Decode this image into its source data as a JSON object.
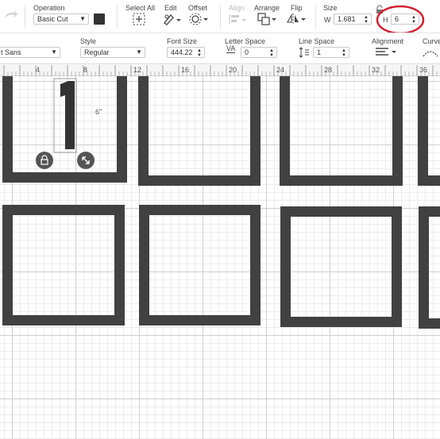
{
  "toolbar": {
    "operation": {
      "label": "Operation",
      "value": "Basic Cut",
      "color": "#333333"
    },
    "select_all": {
      "label": "Select All"
    },
    "edit": {
      "label": "Edit"
    },
    "offset": {
      "label": "Offset"
    },
    "align": {
      "label": "Align"
    },
    "arrange": {
      "label": "Arrange"
    },
    "flip": {
      "label": "Flip"
    },
    "size": {
      "label": "Size",
      "w_label": "W",
      "w_value": "1.681",
      "h_label": "H",
      "h_value": "6"
    }
  },
  "text_toolbar": {
    "font_name": "t Sans",
    "style": {
      "label": "Style",
      "value": "Regular"
    },
    "font_size": {
      "label": "Font Size",
      "value": "444.22"
    },
    "letter_space": {
      "label": "Letter Space",
      "icon_text": "VA",
      "value": "0"
    },
    "line_space": {
      "label": "Line Space",
      "value": "1"
    },
    "alignment": {
      "label": "Alignment"
    },
    "curve": {
      "label": "Curve"
    }
  },
  "ruler": {
    "ticks": [
      "4",
      "8",
      "12",
      "16",
      "20",
      "24",
      "28",
      "32",
      "36"
    ]
  },
  "canvas": {
    "dimension_label": "6\"",
    "selected_glyph": "1"
  },
  "colors": {
    "shape_fill": "#414141",
    "annotation": "#d0202c"
  }
}
